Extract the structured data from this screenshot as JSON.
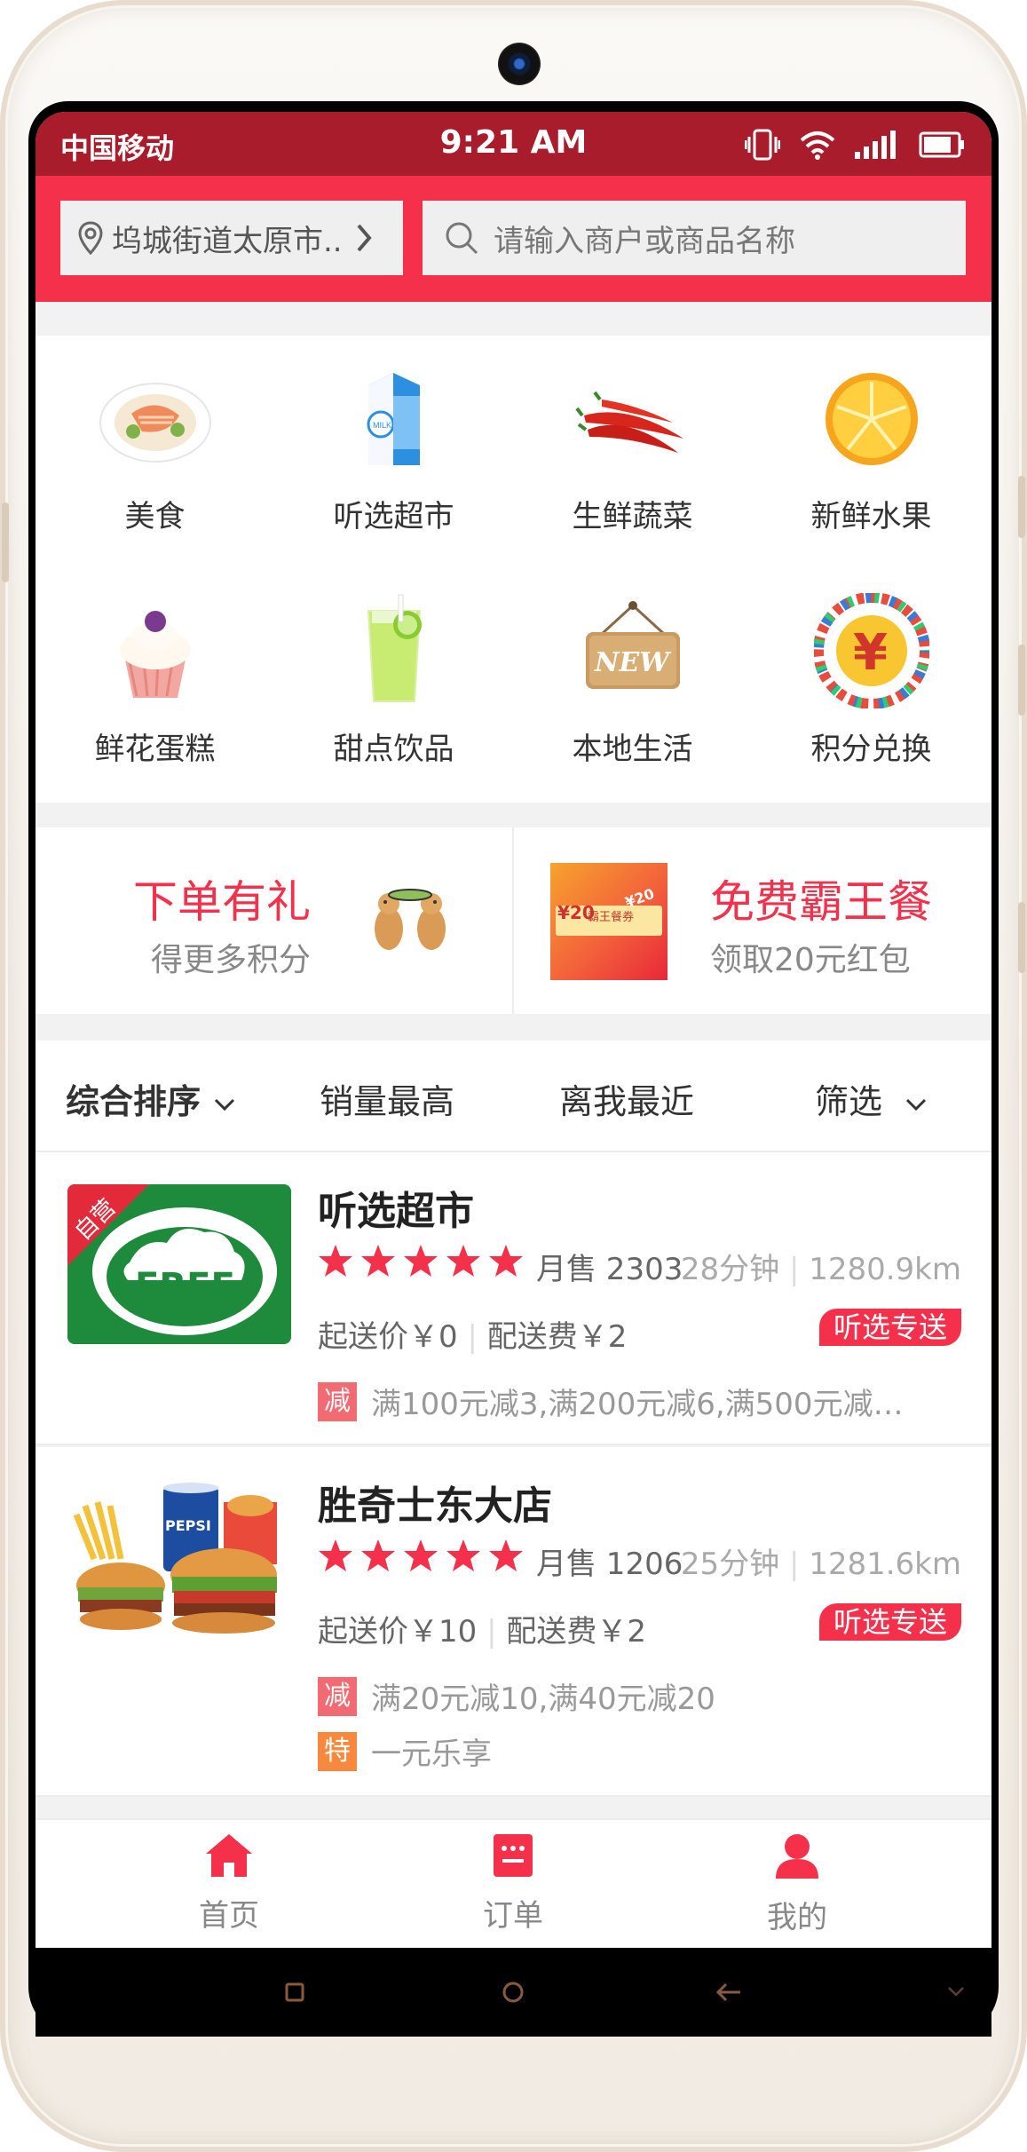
{
  "status": {
    "carrier": "中国移动",
    "time": "9:21 AM"
  },
  "header": {
    "location": "坞城街道太原市..",
    "search_placeholder": "请输入商户或商品名称",
    "icons": [
      "location-pin-icon",
      "chevron-right-icon",
      "search-icon"
    ]
  },
  "categories": [
    {
      "label": "美食",
      "icon": "food-plate-icon"
    },
    {
      "label": "听选超市",
      "icon": "milk-carton-icon"
    },
    {
      "label": "生鲜蔬菜",
      "icon": "chili-pepper-icon"
    },
    {
      "label": "新鲜水果",
      "icon": "orange-icon"
    },
    {
      "label": "鲜花蛋糕",
      "icon": "cupcake-icon"
    },
    {
      "label": "甜点饮品",
      "icon": "drink-icon"
    },
    {
      "label": "本地生活",
      "icon": "new-sign-icon"
    },
    {
      "label": "积分兑换",
      "icon": "yen-coin-icon"
    }
  ],
  "promo": {
    "left_title": "下单有礼",
    "left_sub": "得更多积分",
    "right_title": "免费霸王餐",
    "right_sub": "领取20元红包",
    "voucher_amount": "¥20",
    "voucher_text": "霸王餐券",
    "voucher_value": "¥20"
  },
  "sort": {
    "default": "综合排序",
    "sales": "销量最高",
    "distance": "离我最近",
    "filter": "筛选"
  },
  "stores": [
    {
      "name": "听选超市",
      "sales": "月售 2303",
      "eta": "28分钟",
      "distance": "1280.9km",
      "min_order": "起送价￥0",
      "delivery_fee": "配送费￥2",
      "delivery_tag": "听选专送",
      "ribbon": "自营",
      "logo_text": "FREE",
      "rating": 5,
      "promos": [
        {
          "badge": "减",
          "text": "满100元减3,满200元减6,满500元减…"
        }
      ]
    },
    {
      "name": "胜奇士东大店",
      "sales": "月售 1206",
      "eta": "25分钟",
      "distance": "1281.6km",
      "min_order": "起送价￥10",
      "delivery_fee": "配送费￥2",
      "delivery_tag": "听选专送",
      "logo_text": "PEPSI",
      "rating": 5,
      "promos": [
        {
          "badge": "减",
          "text": "满20元减10,满40元减20"
        },
        {
          "badge": "特",
          "text": "一元乐享"
        }
      ]
    }
  ],
  "bottom_nav": [
    {
      "label": "首页",
      "icon": "home-icon",
      "active": true
    },
    {
      "label": "订单",
      "icon": "order-icon",
      "active": false
    },
    {
      "label": "我的",
      "icon": "profile-icon",
      "active": false
    }
  ],
  "colors": {
    "accent": "#f4304b",
    "status_bar": "#a81c2c"
  }
}
